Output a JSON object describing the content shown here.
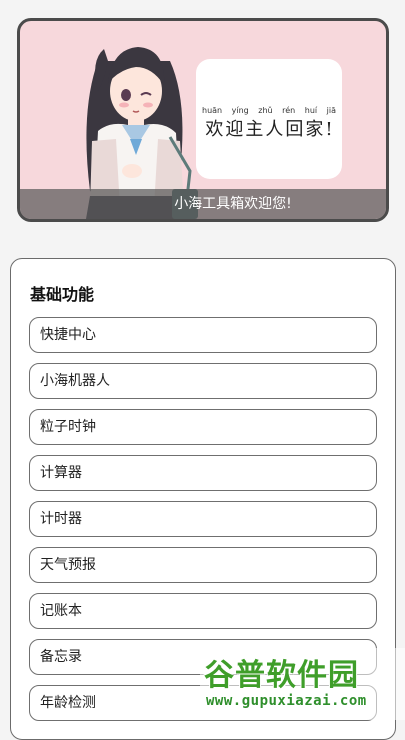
{
  "banner": {
    "speech_pinyin": [
      "huān",
      "yíng",
      "zhǔ",
      "rén",
      "huí",
      "jiā"
    ],
    "speech_text": "欢迎主人回家!",
    "caption": "小海工具箱欢迎您!"
  },
  "functions": {
    "title": "基础功能",
    "items": [
      {
        "label": "快捷中心"
      },
      {
        "label": "小海机器人"
      },
      {
        "label": "粒子时钟"
      },
      {
        "label": "计算器"
      },
      {
        "label": "计时器"
      },
      {
        "label": "天气预报"
      },
      {
        "label": "记账本"
      },
      {
        "label": "备忘录"
      },
      {
        "label": "年龄检测"
      }
    ]
  },
  "watermark": {
    "brand": "谷普软件园",
    "url": "www.gupuxiazai.com"
  },
  "colors": {
    "banner_bg": "#f7d8dc",
    "watermark_green": "#3f9e2a"
  }
}
